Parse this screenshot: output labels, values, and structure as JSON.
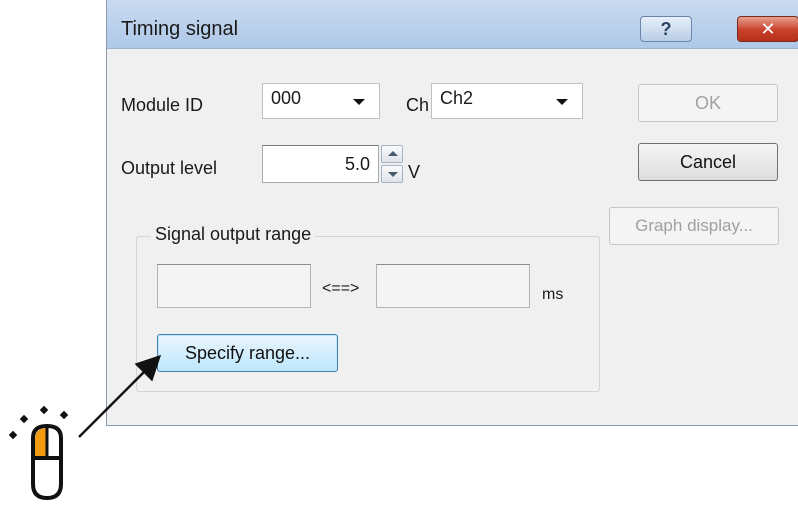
{
  "dialog": {
    "title": "Timing signal",
    "help_glyph": "?",
    "close_glyph": "✕"
  },
  "module_id": {
    "label": "Module ID",
    "value": "000"
  },
  "channel": {
    "label": "Ch",
    "value": "Ch2"
  },
  "output_level": {
    "label": "Output level",
    "value": "5.0",
    "unit": "V"
  },
  "buttons": {
    "ok": "OK",
    "cancel": "Cancel",
    "graph_display": "Graph display...",
    "specify_range": "Specify range..."
  },
  "signal_output_range": {
    "label": "Signal output range",
    "start": "",
    "end": "",
    "separator": "<==>",
    "unit": "ms"
  },
  "icons": [
    "help-icon",
    "close-icon",
    "dropdown-arrow-icon",
    "spin-up-icon",
    "spin-down-icon",
    "mouse-click-icon"
  ],
  "colors": {
    "titlebar": "#aec8e8",
    "close_button": "#c8412a",
    "focus_button": "#bee6fd",
    "mouse_highlight": "#f39c12"
  }
}
